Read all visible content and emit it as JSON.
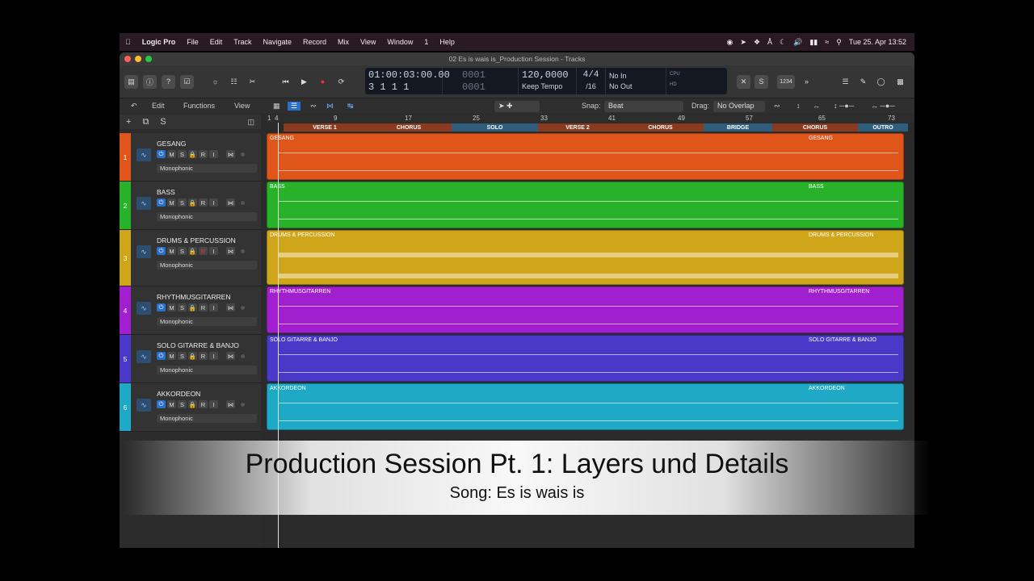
{
  "menubar": {
    "app": "Logic Pro",
    "items": [
      "File",
      "Edit",
      "Track",
      "Navigate",
      "Record",
      "Mix",
      "View",
      "Window",
      "1",
      "Help"
    ],
    "clock": "Tue 25. Apr  13:52"
  },
  "window": {
    "title": "02 Es is wais is_Production Session - Tracks"
  },
  "lcd": {
    "time": "01:00:03:00.00",
    "bars": "3  1  1    1",
    "tempo": "120,0000",
    "tempo_mode": "Keep Tempo",
    "sig_top": "4/4",
    "sig_bottom": "/16",
    "in": "No In",
    "out": "No Out",
    "cpu": "CPU",
    "hd": "HD"
  },
  "toolbar": {
    "edit": "Edit",
    "functions": "Functions",
    "view": "View",
    "snap_label": "Snap:",
    "snap_value": "Beat",
    "drag_label": "Drag:",
    "drag_value": "No Overlap",
    "count": "1234"
  },
  "arrange": {
    "add": "+",
    "s": "S"
  },
  "ruler": [
    "1",
    "4",
    "9",
    "17",
    "25",
    "33",
    "41",
    "49",
    "57",
    "65",
    "73"
  ],
  "markers": [
    "VERSE 1",
    "CHORUS",
    "SOLO",
    "VERSE 2",
    "CHORUS",
    "BRIDGE",
    "CHORUS",
    "OUTRO"
  ],
  "tracks": [
    {
      "num": "1",
      "name": "GESANG",
      "mode": "Monophonic",
      "color": "#e0561a"
    },
    {
      "num": "2",
      "name": "BASS",
      "mode": "Monophonic",
      "color": "#27b22a"
    },
    {
      "num": "3",
      "name": "DRUMS & PERCUSSION",
      "mode": "Monophonic",
      "color": "#cfa619"
    },
    {
      "num": "4",
      "name": "RHYTHMUSGITARREN",
      "mode": "Monophonic",
      "color": "#a21fcf"
    },
    {
      "num": "5",
      "name": "SOLO GITARRE & BANJO",
      "mode": "Monophonic",
      "color": "#4a38c8"
    },
    {
      "num": "6",
      "name": "AKKORDEON",
      "mode": "Monophonic",
      "color": "#1eaac6"
    }
  ],
  "track_buttons": {
    "m": "M",
    "s": "S",
    "r": "R",
    "i": "I"
  },
  "overlay": {
    "title": "Production Session Pt. 1: Layers und Details",
    "subtitle": "Song: Es is wais is"
  }
}
